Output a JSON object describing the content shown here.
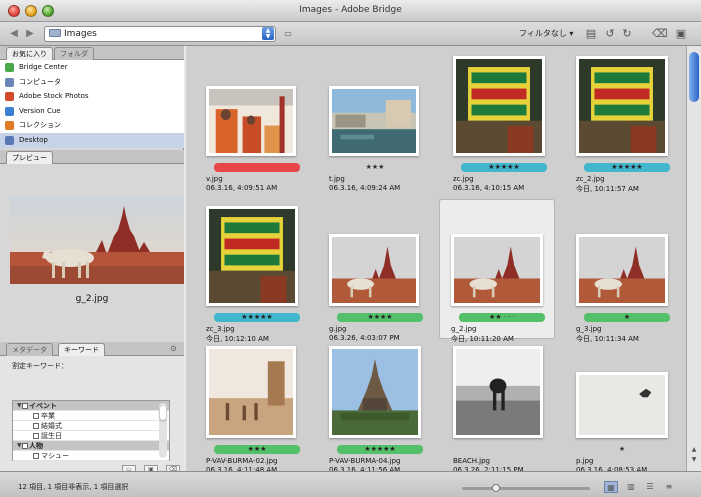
{
  "window": {
    "title": "Images - Adobe Bridge"
  },
  "toolbar": {
    "path": "Images",
    "filter_label": "フィルタなし ▾"
  },
  "left": {
    "tabs": {
      "favorites": "お気に入り",
      "folders": "フォルダ",
      "preview": "プレビュー",
      "metadata": "メタデータ",
      "keywords": "キーワード"
    },
    "favorites": [
      {
        "label": "Bridge Center",
        "color": "#4aa84a"
      },
      {
        "label": "コンピュータ",
        "color": "#6a87b8"
      },
      {
        "label": "Adobe Stock Photos",
        "color": "#d24a2a"
      },
      {
        "label": "Version Cue",
        "color": "#3d7fd0"
      },
      {
        "label": "コレクション",
        "color": "#e07a24"
      },
      {
        "label": "Desktop",
        "color": "#5a79b4"
      }
    ],
    "preview_name": "g_2.jpg",
    "keyword_label": "割定キーワード：",
    "keywords": [
      {
        "label": "イベント",
        "group": true
      },
      {
        "label": "卒業",
        "group": false
      },
      {
        "label": "結婚式",
        "group": false
      },
      {
        "label": "誕生日",
        "group": false
      },
      {
        "label": "人物",
        "group": true
      },
      {
        "label": "マシュー",
        "group": false
      }
    ]
  },
  "items": [
    {
      "name": "v.jpg",
      "date": "06.3.16, 4:09:51 AM",
      "stars": "",
      "label": "#e8474a",
      "img": "monks",
      "selected": false
    },
    {
      "name": "t.jpg",
      "date": "06.3.16, 4:09:24 AM",
      "stars": "★★★",
      "label": "",
      "img": "river",
      "selected": false
    },
    {
      "name": "zc.jpg",
      "date": "06.3.16, 4:10:15 AM",
      "stars": "★★★★★",
      "label": "#41b6cc",
      "img": "sign",
      "selected": false
    },
    {
      "name": "zc_2.jpg",
      "date": "今日, 10:11:57 AM",
      "stars": "★★★★★",
      "label": "#41b6cc",
      "img": "sign",
      "selected": false
    },
    {
      "name": "zc_3.jpg",
      "date": "今日, 10:12:10 AM",
      "stars": "★★★★★",
      "label": "#41b6cc",
      "img": "sign",
      "selected": false
    },
    {
      "name": "g.jpg",
      "date": "06.3.26, 4:03:07 PM",
      "stars": "★★★★",
      "label": "#54c06a",
      "img": "temple",
      "selected": false
    },
    {
      "name": "g_2.jpg",
      "date": "今日, 10:11:20 AM",
      "stars": "★★ · · ·",
      "label": "#54c06a",
      "img": "temple",
      "selected": true
    },
    {
      "name": "g_3.jpg",
      "date": "今日, 10:11:34 AM",
      "stars": "★",
      "label": "#54c06a",
      "img": "temple",
      "selected": false
    },
    {
      "name": "P-VAV-BURMA-02.jpg",
      "date": "06.3.16, 4:11:48 AM",
      "stars": "★★★",
      "label": "#54c06a",
      "img": "village",
      "selected": false
    },
    {
      "name": "P-VAV-BURMA-04.jpg",
      "date": "06.3.16, 4:11:56 AM",
      "stars": "★★★★★",
      "label": "#54c06a",
      "img": "pagoda",
      "selected": false
    },
    {
      "name": "BEACH.jpg",
      "date": "06.3.26, 2:11:15 PM",
      "stars": "",
      "label": "",
      "img": "beach",
      "selected": false
    },
    {
      "name": "p.jpg",
      "date": "06.3.16, 4:08:53 AM",
      "stars": "★",
      "label": "",
      "img": "bird",
      "selected": false
    }
  ],
  "status": {
    "text": "12 項目, 1 項目非表示, 1 項目選択"
  }
}
